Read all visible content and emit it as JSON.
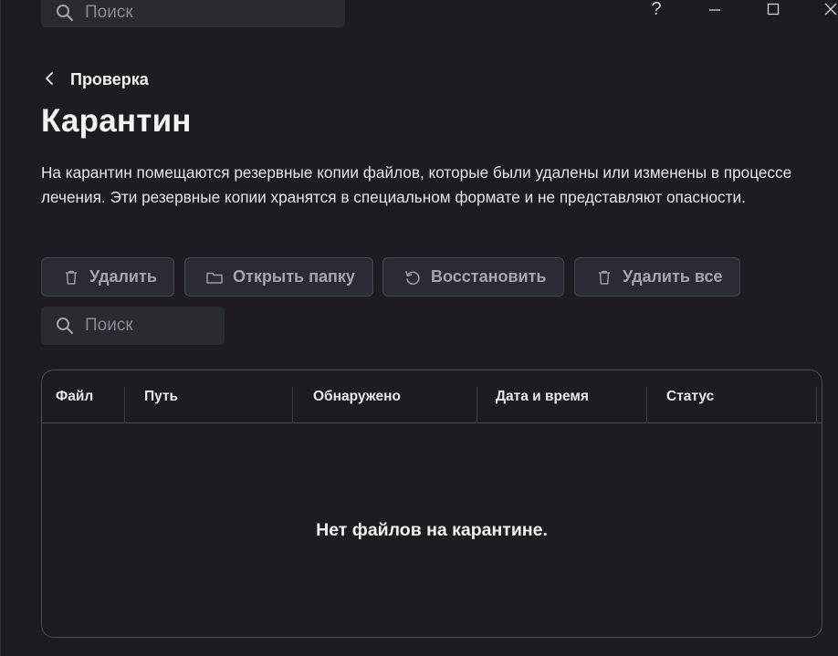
{
  "top_search": {
    "placeholder": "Поиск",
    "icon": "search-icon"
  },
  "window_controls": {
    "help_label": "?",
    "minimize_icon": "minimize-icon",
    "maximize_icon": "maximize-icon",
    "close_icon": "close-icon"
  },
  "breadcrumb": {
    "back_icon": "chevron-left-icon",
    "label": "Проверка"
  },
  "page": {
    "title": "Карантин",
    "description": "На карантин помещаются резервные копии файлов, которые были удалены или изменены в процессе лечения. Эти резервные копии хранятся в специальном формате и не представляют опасности."
  },
  "toolbar": {
    "delete_label": "Удалить",
    "open_folder_label": "Открыть папку",
    "restore_label": "Восстановить",
    "delete_all_label": "Удалить все",
    "delete_icon": "trash-icon",
    "open_folder_icon": "folder-icon",
    "restore_icon": "restore-icon",
    "delete_all_icon": "trash-icon"
  },
  "list_search": {
    "placeholder": "Поиск",
    "icon": "search-icon"
  },
  "table": {
    "columns": [
      "Файл",
      "Путь",
      "Обнаружено",
      "Дата и время",
      "Статус"
    ],
    "rows": [],
    "empty_message": "Нет файлов на карантине."
  },
  "colors": {
    "background": "#1d1c23",
    "button_bg": "#2b2c33",
    "button_text": "#a5a5ac",
    "text_primary": "#f2f2f5"
  }
}
